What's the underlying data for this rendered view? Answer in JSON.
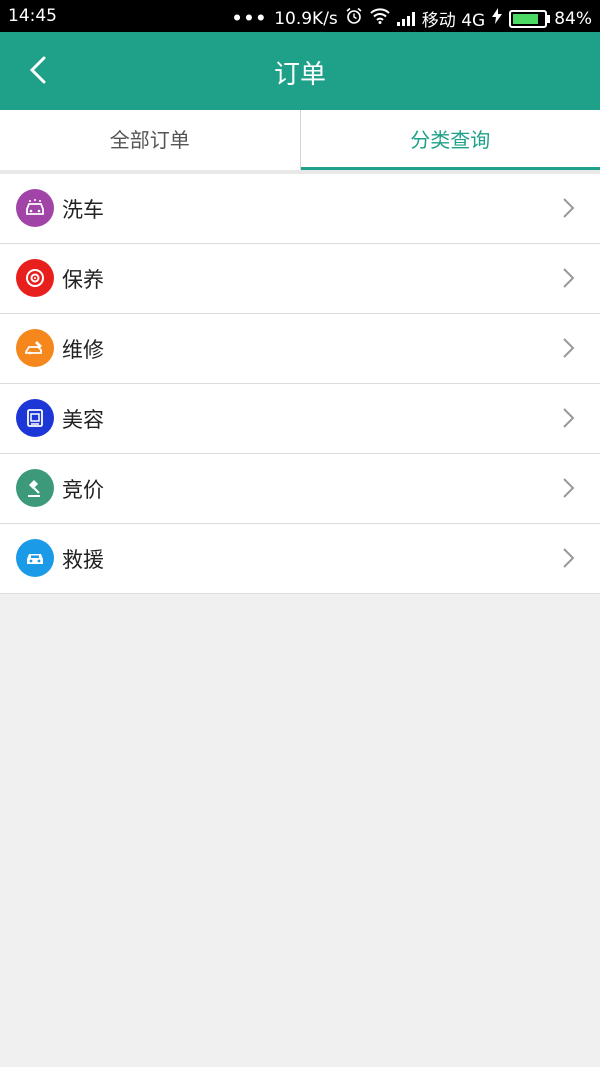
{
  "status_bar": {
    "time": "14:45",
    "dots": "•••",
    "speed": "10.9K/s",
    "carrier": "移动 4G",
    "battery": "84%",
    "battery_level": 0.84
  },
  "app_bar": {
    "title": "订单",
    "back_icon": "chevron-left-icon"
  },
  "tabs": [
    {
      "label": "全部订单",
      "active": false
    },
    {
      "label": "分类查询",
      "active": true
    }
  ],
  "categories": [
    {
      "label": "洗车",
      "icon": "car-wash-icon",
      "color": "#a044a8"
    },
    {
      "label": "保养",
      "icon": "brake-disc-icon",
      "color": "#e8201d"
    },
    {
      "label": "维修",
      "icon": "repair-icon",
      "color": "#f5871c"
    },
    {
      "label": "美容",
      "icon": "beauty-icon",
      "color": "#1d36d6"
    },
    {
      "label": "竞价",
      "icon": "auction-gavel-icon",
      "color": "#3c9a7a"
    },
    {
      "label": "救援",
      "icon": "rescue-car-icon",
      "color": "#1b9ae8"
    }
  ],
  "colors": {
    "primary": "#1fa189",
    "background": "#f0f0f0"
  }
}
